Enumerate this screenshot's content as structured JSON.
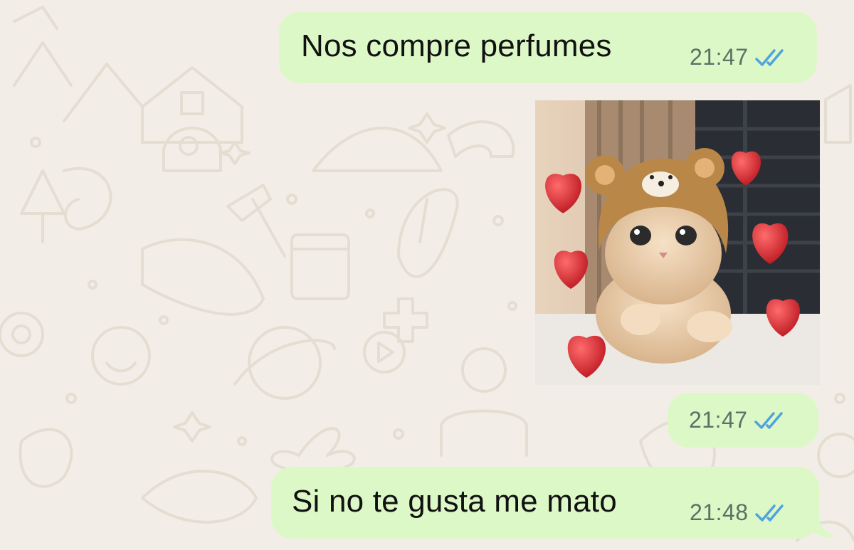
{
  "chat": {
    "messages": [
      {
        "type": "text",
        "text": "Nos compre perfumes",
        "time": "21:47",
        "status": "read-double-check"
      },
      {
        "type": "sticker",
        "sticker": "cat-in-bear-hat-with-hearts",
        "time": "21:47",
        "status": "read-double-check"
      },
      {
        "type": "text",
        "text": "Si no te gusta me mato",
        "time": "21:48",
        "status": "read-double-check"
      }
    ]
  },
  "colors": {
    "outgoing_bubble": "#dcf8c6",
    "background": "#f2eee7",
    "tick_read": "#4fa3e0",
    "timestamp": "#5f6f66"
  }
}
